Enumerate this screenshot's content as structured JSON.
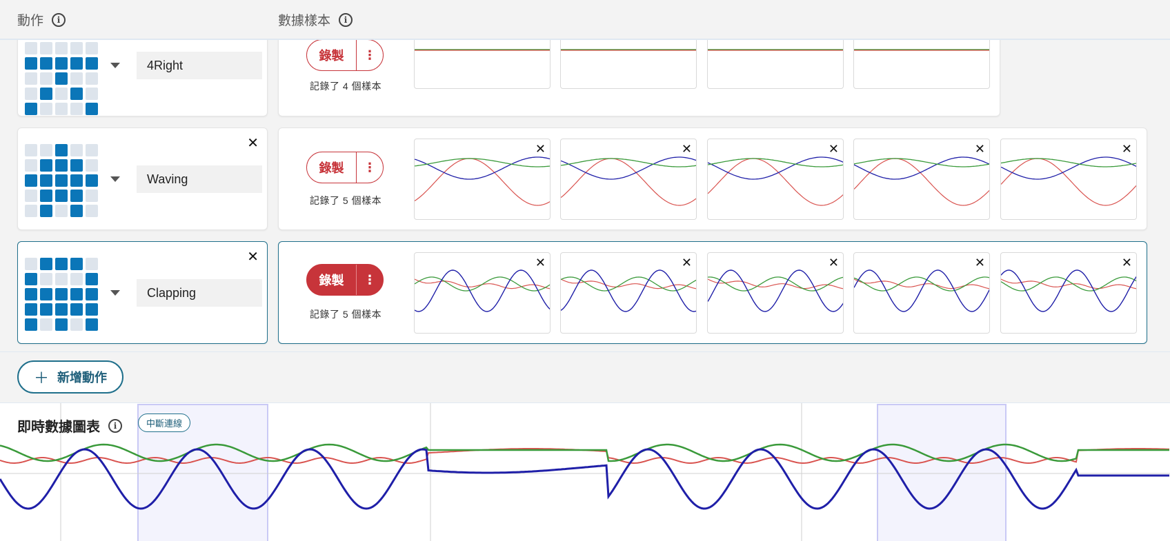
{
  "header": {
    "actions_label": "動作",
    "samples_label": "數據樣本"
  },
  "gestures": [
    {
      "name": "4Right",
      "grid": [
        0,
        0,
        0,
        0,
        0,
        1,
        1,
        1,
        1,
        1,
        0,
        0,
        1,
        0,
        0,
        0,
        1,
        0,
        1,
        0,
        1,
        0,
        0,
        0,
        1
      ],
      "record_label": "錄製",
      "count_text": "記錄了 4 個樣本",
      "sample_count": 4
    },
    {
      "name": "Waving",
      "grid": [
        0,
        0,
        1,
        0,
        0,
        0,
        1,
        1,
        1,
        0,
        1,
        1,
        1,
        1,
        1,
        0,
        1,
        1,
        1,
        0,
        0,
        1,
        0,
        1,
        0
      ],
      "record_label": "錄製",
      "count_text": "記錄了 5 個樣本",
      "sample_count": 5
    },
    {
      "name": "Clapping",
      "grid": [
        0,
        1,
        1,
        1,
        0,
        1,
        0,
        0,
        0,
        1,
        1,
        1,
        1,
        1,
        1,
        1,
        1,
        1,
        1,
        1,
        1,
        0,
        1,
        0,
        1
      ],
      "record_label": "錄製",
      "count_text": "記錄了 5 個樣本",
      "sample_count": 5
    }
  ],
  "add_action_label": "新增動作",
  "live_chart": {
    "title": "即時數據圖表",
    "status_badge": "中斷連線"
  },
  "colors": {
    "x_axis": "#d9534f",
    "y_axis": "#3a9a3a",
    "z_axis": "#1f1fa8",
    "accent": "#1f6f8b",
    "record": "#c7343a",
    "led_on": "#0b76b8",
    "led_off": "#dde4ec"
  },
  "icons": {
    "info": "info-circle-icon",
    "close": "close-icon",
    "dropdown": "caret-down-icon",
    "more": "more-vertical-icon",
    "add": "plus-icon"
  }
}
